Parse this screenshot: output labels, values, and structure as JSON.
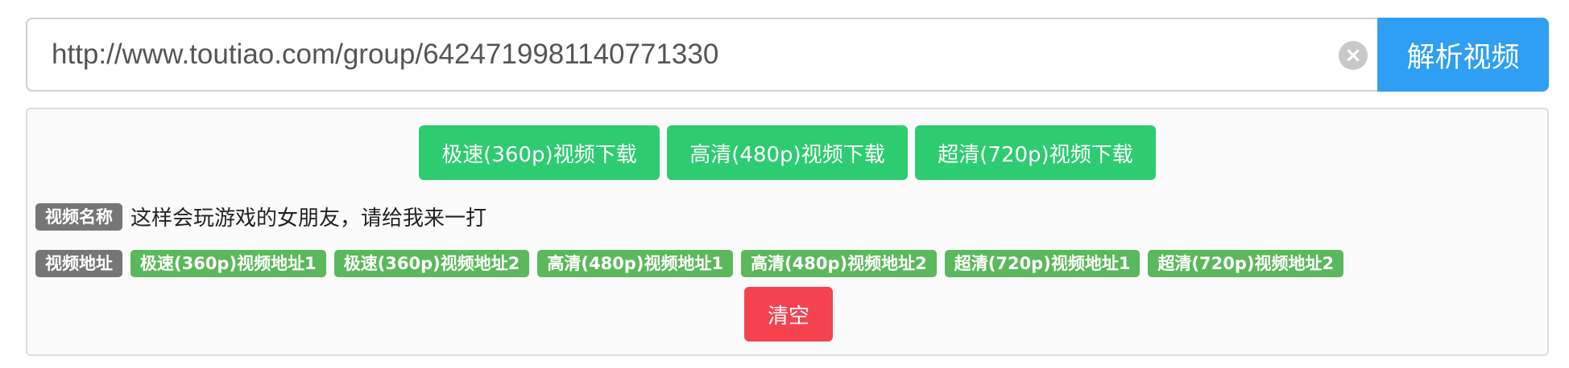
{
  "search": {
    "url_value": "http://www.toutiao.com/group/6424719981140771330",
    "clear_icon": "clear-circle-icon",
    "parse_button": "解析视频"
  },
  "downloads": [
    {
      "label": "极速(360p)视频下载"
    },
    {
      "label": "高清(480p)视频下载"
    },
    {
      "label": "超清(720p)视频下载"
    }
  ],
  "video_name": {
    "label": "视频名称",
    "value": "这样会玩游戏的女朋友，请给我来一打"
  },
  "video_address": {
    "label": "视频地址",
    "links": [
      {
        "label": "极速(360p)视频地址1"
      },
      {
        "label": "极速(360p)视频地址2"
      },
      {
        "label": "高清(480p)视频地址1"
      },
      {
        "label": "高清(480p)视频地址2"
      },
      {
        "label": "超清(720p)视频地址1"
      },
      {
        "label": "超清(720p)视频地址2"
      }
    ]
  },
  "clear_button": "清空",
  "colors": {
    "primary": "#2e9ff3",
    "success": "#2ecc71",
    "tag_green": "#5cb85c",
    "label_gray": "#767676",
    "danger": "#f4434f"
  }
}
